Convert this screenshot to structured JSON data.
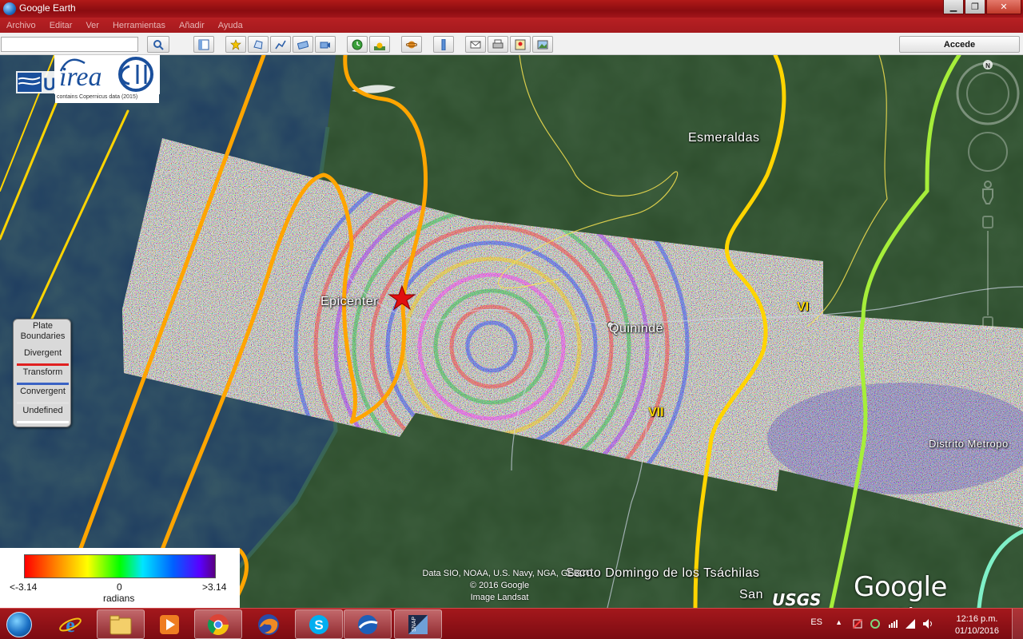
{
  "window": {
    "title": "Google Earth",
    "buttons": [
      "minimize",
      "maximize",
      "close"
    ]
  },
  "menu": [
    "Archivo",
    "Editar",
    "Ver",
    "Herramientas",
    "Añadir",
    "Ayuda"
  ],
  "toolbar": {
    "search_value": "",
    "signin_label": "Accede",
    "icons": [
      "search-icon",
      "sidebar-icon",
      "placemark-icon",
      "polygon-icon",
      "path-icon",
      "image-overlay-icon",
      "record-tour-icon",
      "historical-imagery-icon",
      "sunlight-icon",
      "planet-icon",
      "ruler-icon",
      "email-icon",
      "print-icon",
      "view-in-maps-icon",
      "save-image-icon"
    ]
  },
  "overlay": {
    "logo_caption": "contains Copernicus data (2015)",
    "logos": [
      "UPV logo",
      "irea logo",
      "CNR logo"
    ]
  },
  "map": {
    "labels": {
      "esmeraldas": "Esmeraldas",
      "epicenter": "Epicenter",
      "quininde": "Quinindé",
      "distrito": "Distrito Metropo",
      "santo_domingo": "Santo Domingo de los Tsáchilas",
      "san": "San"
    },
    "intensity": {
      "vi": "VI",
      "vii": "VII"
    }
  },
  "plate_legend": {
    "title": "Plate\nBoundaries",
    "items": [
      {
        "label": "Divergent",
        "color": "#e02020"
      },
      {
        "label": "Transform",
        "color": "#3a62c4"
      },
      {
        "label": "Convergent",
        "color": "#e0e0e0"
      },
      {
        "label": "Undefined",
        "color": "#ffffff"
      }
    ]
  },
  "phase_scale": {
    "min_label": "<-3.14",
    "mid_label": "0",
    "max_label": ">3.14",
    "unit": "radians"
  },
  "attribution": {
    "line1": "Data SIO, NOAA, U.S. Navy, NGA, GEBCO",
    "line2": "© 2016 Google",
    "line3": "Image Landsat",
    "brand": "Google earth",
    "usgs": "USGS"
  },
  "taskbar": {
    "apps": [
      "internet-explorer",
      "file-explorer",
      "media-player",
      "chrome",
      "firefox",
      "skype",
      "google-earth",
      "snap"
    ],
    "language": "ES",
    "time": "12:16 p.m.",
    "date": "01/10/2016"
  },
  "colors": {
    "contour_orange": "#ffa500",
    "contour_yellow": "#ffd400",
    "contour_green": "#a6ee3a",
    "contour_teal": "#7ff0c8",
    "epicenter_star": "#e01010",
    "taskbar": "#8f0f14"
  }
}
